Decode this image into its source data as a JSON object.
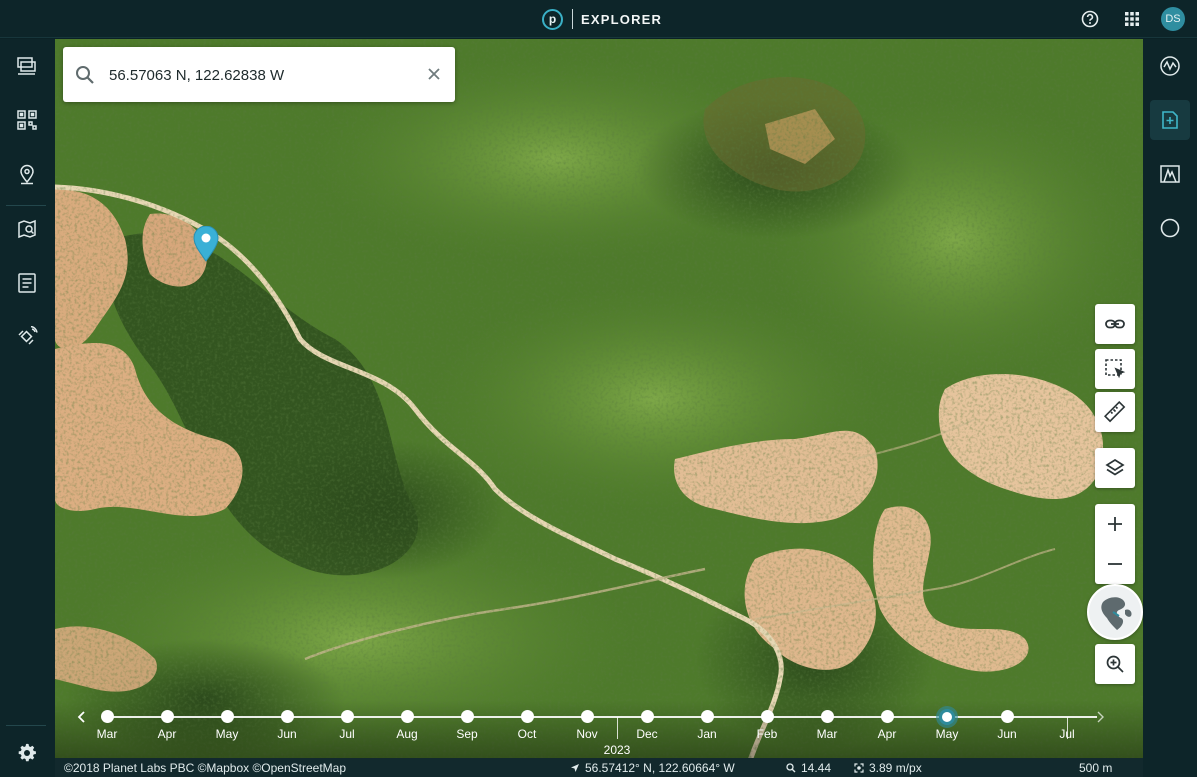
{
  "header": {
    "brand_glyph": "p",
    "brand_title": "EXPLORER",
    "icons": [
      "help-icon",
      "apps-grid-icon"
    ],
    "avatar_initials": "DS"
  },
  "left_sidebar": {
    "items": [
      {
        "icon": "imagery-stack-icon"
      },
      {
        "icon": "qr-scan-icon"
      },
      {
        "icon": "location-pin-icon"
      },
      {
        "icon": "map-pin-list-icon"
      },
      {
        "icon": "notes-list-icon"
      },
      {
        "icon": "satellite-tasking-icon"
      }
    ],
    "footer_icon": "settings-gear-icon"
  },
  "right_sidebar": {
    "items": [
      {
        "icon": "analysis-spectrum-icon",
        "active": false
      },
      {
        "icon": "add-annotation-icon",
        "active": true
      },
      {
        "icon": "terrain-profile-icon",
        "active": false
      },
      {
        "icon": "contrast-moon-icon",
        "active": false
      }
    ]
  },
  "search": {
    "value": "56.57063 N, 122.62838 W",
    "placeholder": "Search"
  },
  "map_controls": {
    "items": [
      "link-icon",
      "select-area-icon",
      "measure-ruler-icon",
      "layers-icon"
    ],
    "zoom_in": "zoom-in-plus-icon",
    "zoom_out": "zoom-out-minus-icon",
    "globe": "globe-icon",
    "zoom_to": "zoom-magnifier-icon"
  },
  "timeline": {
    "months": [
      "Mar",
      "Apr",
      "May",
      "Jun",
      "Jul",
      "Aug",
      "Sep",
      "Oct",
      "Nov",
      "Dec",
      "Jan",
      "Feb",
      "Mar",
      "Apr",
      "May",
      "Jun",
      "Jul"
    ],
    "year_label": "2023",
    "selected_month_index": 14,
    "months_with_imagery": 16
  },
  "status": {
    "attribution": "©2018 Planet Labs PBC ©Mapbox ©OpenStreetMap",
    "cursor_coords": "56.57412° N, 122.60664° W",
    "zoom_level": "14.44",
    "resolution": "3.89 m/px",
    "scale": "500 m"
  },
  "colors": {
    "chrome_bg": "#0d2529",
    "accent": "#2e8b9c",
    "marker": "#3ab0d6"
  }
}
